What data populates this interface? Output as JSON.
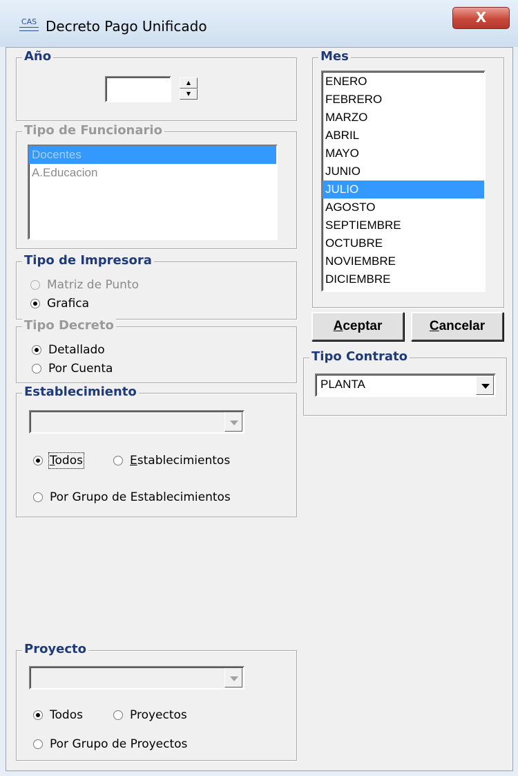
{
  "window": {
    "title": "Decreto Pago Unificado",
    "close_label": "X",
    "app_icon_text": "CAS"
  },
  "anio": {
    "legend": "Año",
    "value": ""
  },
  "tipo_funcionario": {
    "legend": "Tipo de Funcionario",
    "items": [
      "Docentes",
      "A.Educacion"
    ]
  },
  "tipo_impresora": {
    "legend": "Tipo de Impresora",
    "option_1": "Matriz de Punto",
    "option_2": "Grafica"
  },
  "tipo_decreto": {
    "legend": "Tipo Decreto",
    "option_1": "Detallado",
    "option_2": "Por Cuenta"
  },
  "establecimiento": {
    "legend": "Establecimiento",
    "combo_value": "",
    "opt_todos_first": "T",
    "opt_todos_rest": "odos",
    "opt_est_first": "E",
    "opt_est_rest": "stablecimientos",
    "opt_grupo": "Por Grupo de Establecimientos"
  },
  "proyecto": {
    "legend": "Proyecto",
    "combo_value": "",
    "opt_todos": "Todos",
    "opt_proyectos": "Proyectos",
    "opt_grupo": "Por Grupo de Proyectos"
  },
  "mes": {
    "legend": "Mes",
    "items": [
      "ENERO",
      "FEBRERO",
      "MARZO",
      "ABRIL",
      "MAYO",
      "JUNIO",
      "JULIO",
      "AGOSTO",
      "SEPTIEMBRE",
      "OCTUBRE",
      "NOVIEMBRE",
      "DICIEMBRE"
    ],
    "selected": "JULIO"
  },
  "buttons": {
    "aceptar_first": "A",
    "aceptar_rest": "ceptar",
    "cancelar_first": "C",
    "cancelar_rest": "ancelar"
  },
  "tipo_contrato": {
    "legend": "Tipo Contrato",
    "value": "PLANTA"
  },
  "colors": {
    "selection": "#3399ff",
    "legend_text": "#1f3a78",
    "close_button": "#c8483a"
  }
}
